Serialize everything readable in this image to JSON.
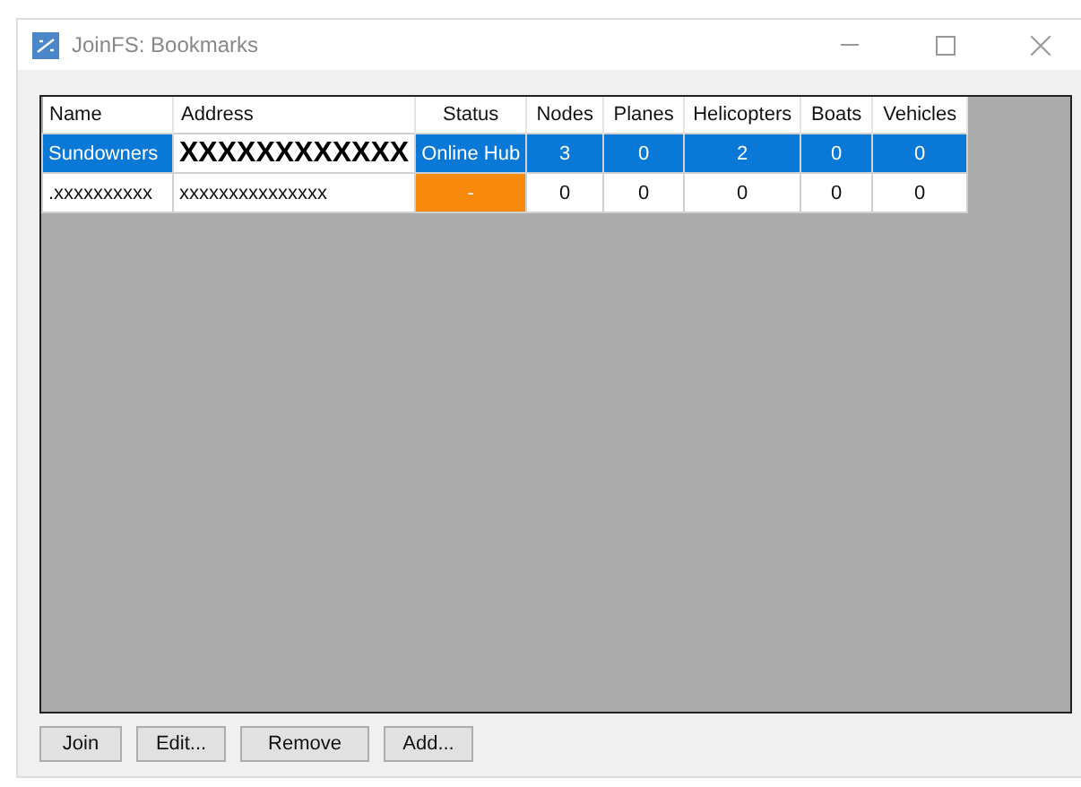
{
  "window": {
    "title": "JoinFS: Bookmarks"
  },
  "table": {
    "columns": [
      "Name",
      "Address",
      "Status",
      "Nodes",
      "Planes",
      "Helicopters",
      "Boats",
      "Vehicles"
    ],
    "rows": [
      {
        "selected": true,
        "address_large": true,
        "color": "#0a78d7",
        "cells": [
          "Sundowners",
          "XXXXXXXXXXXX",
          "Online Hub",
          "3",
          "0",
          "2",
          "0",
          "0"
        ]
      },
      {
        "selected": false,
        "address_large": false,
        "color": "#f7890c",
        "cells": [
          ".xxxxxxxxxx",
          "xxxxxxxxxxxxxxx",
          "-",
          "0",
          "0",
          "0",
          "0",
          "0"
        ]
      }
    ]
  },
  "buttons": [
    "Join",
    "Edit...",
    "Remove",
    "Add..."
  ]
}
